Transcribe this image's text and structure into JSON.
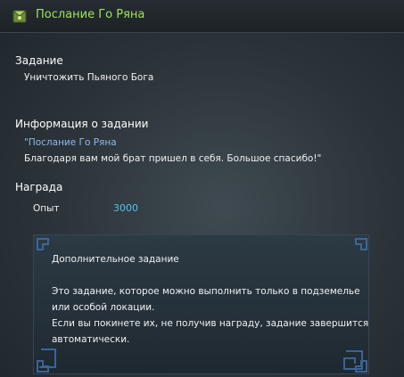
{
  "window": {
    "title": "Послание Го Ряна",
    "icon": "quest-scroll-icon"
  },
  "quest": {
    "task_heading": "Задание",
    "task_text": "Уничтожить Пьяного Бога",
    "info_heading": "Информация о задании",
    "info_title": "\"Послание Го Ряна",
    "info_text": "Благодаря вам мой брат пришел в себя. Большое спасибо!\"",
    "reward_heading": "Награда",
    "reward_label": "Опыт",
    "reward_value": "3000"
  },
  "extra": {
    "title": "Дополнительное задание",
    "line1": "Это задание, которое можно выполнить только в подземелье",
    "line2": "или особой локации.",
    "line3": "Если вы покинете их, не получив награду, задание завершится",
    "line4": "автоматически."
  },
  "colors": {
    "title": "#9fe35c",
    "quest_title": "#8fb7ea",
    "reward_value": "#52c3ee",
    "panel_border": "#34465a"
  }
}
